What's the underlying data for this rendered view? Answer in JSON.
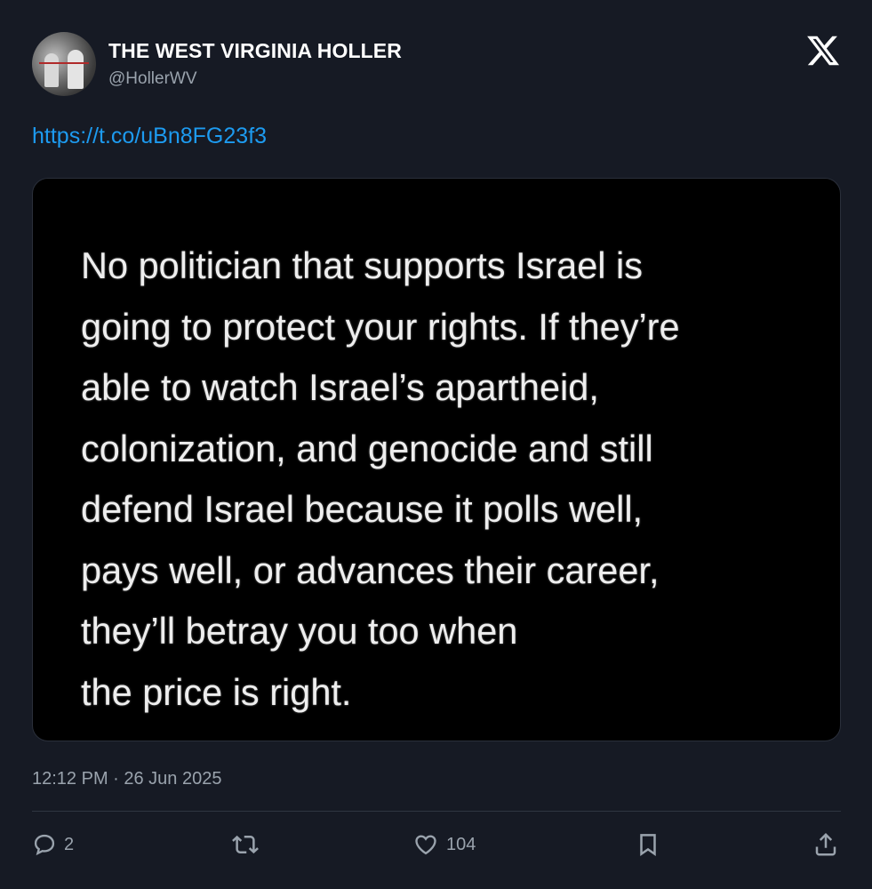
{
  "author": {
    "name": "THE WEST VIRGINIA HOLLER",
    "handle": "@HollerWV"
  },
  "tweet": {
    "link": "https://t.co/uBn8FG23f3",
    "image_text": "No politician that supports Israel is\ngoing to protect your rights. If they’re\nable to watch Israel’s apartheid,\ncolonization, and genocide and still\ndefend Israel because it polls well,\npays well, or advances their career,\nthey’ll betray you too when\nthe price is right.",
    "timestamp": "12:12 PM · 26 Jun 2025"
  },
  "actions": {
    "replies": "2",
    "likes": "104"
  },
  "icons": [
    "x-logo-icon",
    "reply-icon",
    "retweet-icon",
    "like-icon",
    "bookmark-icon",
    "share-icon"
  ],
  "colors": {
    "background": "#161a24",
    "link": "#1d9bf0",
    "muted": "#9aa3ad"
  }
}
